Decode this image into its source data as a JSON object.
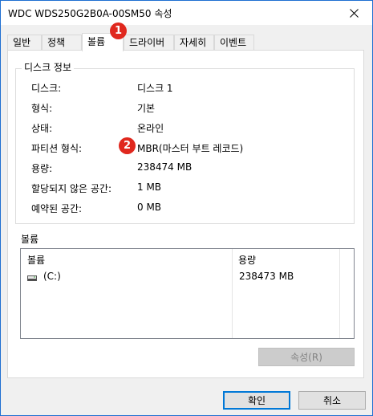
{
  "window": {
    "title": "WDC WDS250G2B0A-00SM50 속성"
  },
  "tabs": [
    {
      "label": "일반"
    },
    {
      "label": "정책"
    },
    {
      "label": "볼륨"
    },
    {
      "label": "드라이버"
    },
    {
      "label": "자세히"
    },
    {
      "label": "이벤트"
    }
  ],
  "active_tab": "볼륨",
  "disk_info": {
    "legend": "디스크 정보",
    "rows": [
      {
        "label": "디스크:",
        "value": "디스크 1"
      },
      {
        "label": "형식:",
        "value": "기본"
      },
      {
        "label": "상태:",
        "value": "온라인"
      },
      {
        "label": "파티션 형식:",
        "value": "MBR(마스터 부트 레코드)"
      },
      {
        "label": "용량:",
        "value": "238474 MB"
      },
      {
        "label": "할당되지 않은 공간:",
        "value": "1 MB"
      },
      {
        "label": "예약된 공간:",
        "value": "0 MB"
      }
    ]
  },
  "volumes": {
    "section_label": "볼륨",
    "columns": [
      "볼륨",
      "용량"
    ],
    "rows": [
      {
        "name": "(C:)",
        "capacity": "238473 MB",
        "icon": "drive-icon"
      }
    ]
  },
  "buttons": {
    "properties": "속성(R)",
    "ok": "확인",
    "cancel": "취소"
  },
  "markers": [
    "1",
    "2"
  ],
  "colors": {
    "marker": "#e0281e",
    "window_border": "#1f6fd1",
    "default_button_border": "#0078d7"
  }
}
